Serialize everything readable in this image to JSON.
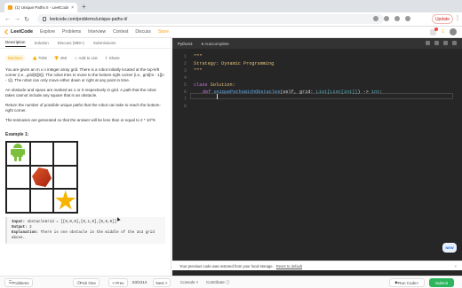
{
  "browser": {
    "tab_title": "(1) Unique Paths II - LeetCode",
    "new_tab": "+",
    "url": "leetcode.com/problems/unique-paths-ii/",
    "update_label": "Update",
    "back": "←",
    "forward": "→",
    "reload": "↻",
    "tab_close": "×",
    "kebab": "⋮"
  },
  "nav": {
    "logo": "LeetCode",
    "items": [
      "Explore",
      "Problems",
      "Interview",
      "Contest",
      "Discuss",
      "Store"
    ],
    "streak": "1"
  },
  "left_tabs": [
    "Description",
    "Solution",
    "Discuss (999+)",
    "Submissions"
  ],
  "problem": {
    "difficulty": "Medium",
    "likes": "7025",
    "dislikes": "450",
    "add_to_list": "Add to List",
    "share": "Share",
    "desc1": "You are given an m x n integer array grid. There is a robot initially located at the top-left corner (i.e., grid[0][0]). The robot tries to move to the bottom-right corner (i.e., grid[m - 1][n - 1]). The robot can only move either down or right at any point in time.",
    "desc2": "An obstacle and space are marked as 1 or 0 respectively in grid. A path that the robot takes cannot include any square that is an obstacle.",
    "desc3": "Return the number of possible unique paths that the robot can take to reach the bottom-right corner.",
    "desc4": "The testcases are generated so that the answer will be less than or equal to 2 * 10^9.",
    "example_title": "Example 1:",
    "input_label": "Input:",
    "input_value": "obstacleGrid = [[0,0,0],[0,1,0],[0,0,0]]",
    "output_label": "Output:",
    "output_value": "2",
    "explanation_label": "Explanation:",
    "explanation_value": "There is one obstacle in the middle of the 3x3 grid above."
  },
  "editor": {
    "language": "Python3",
    "autocomplete": "Autocomplete",
    "lines": [
      "1",
      "2",
      "3",
      "4",
      "5",
      "6",
      "7",
      "8"
    ],
    "code_doc_open": "\"\"\"",
    "code_strategy": "Strategy: Dynamic Programming",
    "code_doc_close": "\"\"\"",
    "code_class_kw": "class",
    "code_class_name": "Solution:",
    "code_def_kw": "def",
    "code_fn_name": "uniquePathsWithObstacles",
    "code_params_a": "(self, grid: ",
    "code_type": "List[List[int]]",
    "code_params_b": ") -> ",
    "code_ret": "int",
    "code_colon": ":"
  },
  "restore": {
    "message": "Your previous code was restored from your local storage.",
    "link": "Reset to default",
    "close": "×"
  },
  "new_badge": "NEW",
  "bottom": {
    "problems": "Problems",
    "pick_one": "Pick One",
    "prev": "< Prev",
    "page": "63/2414",
    "next": "Next >",
    "console": "Console",
    "contribute": "Contribute",
    "run_code": "Run Code",
    "submit": "Submit"
  }
}
